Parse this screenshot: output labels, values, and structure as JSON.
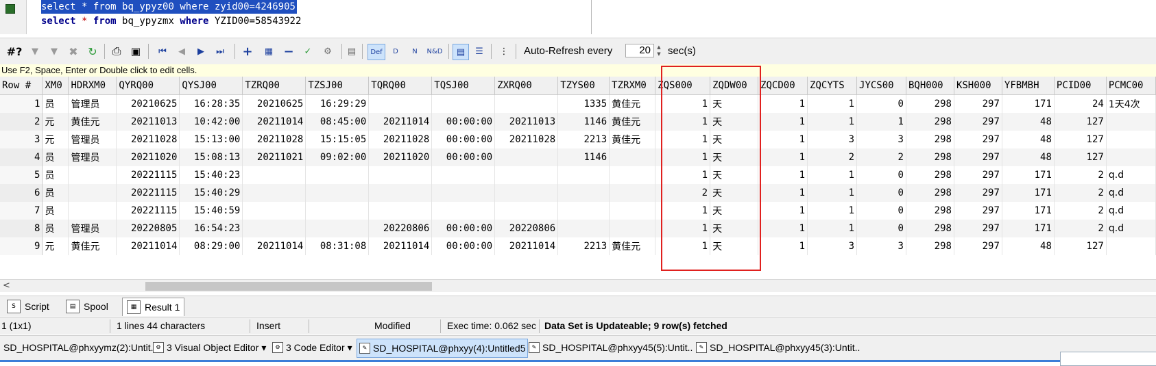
{
  "editor": {
    "lines": [
      {
        "kw1": "select",
        "star": "*",
        "kw2": "from",
        "table": "bq_ypyz00",
        "kw3": "where",
        "cond": "zyid00=4246905",
        "selected": true
      },
      {
        "kw1": "select",
        "star": "*",
        "kw2": "from",
        "table": "bq_ypyzmx",
        "kw3": "where",
        "cond": "YZID00=58543922",
        "selected": false
      }
    ]
  },
  "toolbar": {
    "hash_label": "#?",
    "def_label": "Def",
    "d_label": "D",
    "n_label": "N",
    "nd_label": "N&D",
    "auto_refresh_label": "Auto-Refresh every",
    "refresh_value": "20",
    "refresh_unit": "sec(s)"
  },
  "hint": "Use F2, Space, Enter or Double click to edit cells.",
  "grid": {
    "columns": [
      "Row #",
      "XM0",
      "HDRXM0",
      "QYRQ00",
      "QYSJ00",
      "TZRQ00",
      "TZSJ00",
      "TQRQ00",
      "TQSJ00",
      "ZXRQ00",
      "TZYS00",
      "TZRXM0",
      "ZQS000",
      "ZQDW00",
      "ZQCD00",
      "ZQCYTS",
      "JYCS00",
      "BQH000",
      "KSH000",
      "YFBMBH",
      "PCID00",
      "PCMC00"
    ],
    "rows": [
      [
        "1",
        "员",
        "管理员",
        "20210625",
        "16:28:35",
        "20210625",
        "16:29:29",
        "",
        "",
        "",
        "1335",
        "黄佳元",
        "1",
        "天",
        "1",
        "1",
        "0",
        "298",
        "297",
        "171",
        "24",
        "1天4次"
      ],
      [
        "2",
        "元",
        "黄佳元",
        "20211013",
        "10:42:00",
        "20211014",
        "08:45:00",
        "20211014",
        "00:00:00",
        "20211013",
        "1146",
        "黄佳元",
        "1",
        "天",
        "1",
        "1",
        "1",
        "298",
        "297",
        "48",
        "127",
        ""
      ],
      [
        "3",
        "元",
        "管理员",
        "20211028",
        "15:13:00",
        "20211028",
        "15:15:05",
        "20211028",
        "00:00:00",
        "20211028",
        "2213",
        "黄佳元",
        "1",
        "天",
        "1",
        "3",
        "3",
        "298",
        "297",
        "48",
        "127",
        ""
      ],
      [
        "4",
        "员",
        "管理员",
        "20211020",
        "15:08:13",
        "20211021",
        "09:02:00",
        "20211020",
        "00:00:00",
        "",
        "1146",
        "",
        "1",
        "天",
        "1",
        "2",
        "2",
        "298",
        "297",
        "48",
        "127",
        ""
      ],
      [
        "5",
        "员",
        "",
        "20221115",
        "15:40:23",
        "",
        "",
        "",
        "",
        "",
        "",
        "",
        "1",
        "天",
        "1",
        "1",
        "0",
        "298",
        "297",
        "171",
        "2",
        "q.d"
      ],
      [
        "6",
        "员",
        "",
        "20221115",
        "15:40:29",
        "",
        "",
        "",
        "",
        "",
        "",
        "",
        "2",
        "天",
        "1",
        "1",
        "0",
        "298",
        "297",
        "171",
        "2",
        "q.d"
      ],
      [
        "7",
        "员",
        "",
        "20221115",
        "15:40:59",
        "",
        "",
        "",
        "",
        "",
        "",
        "",
        "1",
        "天",
        "1",
        "1",
        "0",
        "298",
        "297",
        "171",
        "2",
        "q.d"
      ],
      [
        "8",
        "员",
        "管理员",
        "20220805",
        "16:54:23",
        "",
        "",
        "20220806",
        "00:00:00",
        "20220806",
        "",
        "",
        "1",
        "天",
        "1",
        "1",
        "0",
        "298",
        "297",
        "171",
        "2",
        "q.d"
      ],
      [
        "9",
        "元",
        "黄佳元",
        "20211014",
        "08:29:00",
        "20211014",
        "08:31:08",
        "20211014",
        "00:00:00",
        "20211014",
        "2213",
        "黄佳元",
        "1",
        "天",
        "1",
        "3",
        "3",
        "298",
        "297",
        "48",
        "127",
        ""
      ]
    ]
  },
  "hscroll_arrow": "<",
  "tabs": [
    {
      "label": "Script",
      "active": false
    },
    {
      "label": "Spool",
      "active": false
    },
    {
      "label": "Result 1",
      "active": true
    }
  ],
  "status": {
    "position": "1 (1x1)",
    "lines_info": "1 lines 44 characters",
    "mode": "Insert",
    "modified": "Modified",
    "exec_time": "Exec time: 0.062 sec",
    "message": "Data Set is Updateable; 9 row(s) fetched"
  },
  "taskbar": [
    {
      "label": "SD_HOSPITAL@phxyymz(2):Untit..",
      "active": false
    },
    {
      "label": "3 Visual Object Editor",
      "active": false
    },
    {
      "label": "3 Code Editor",
      "active": false
    },
    {
      "label": "SD_HOSPITAL@phxyy(4):Untitled5",
      "active": true
    },
    {
      "label": "SD_HOSPITAL@phxyy45(5):Untit..",
      "active": false
    },
    {
      "label": "SD_HOSPITAL@phxyy45(3):Untit..",
      "active": false
    }
  ]
}
